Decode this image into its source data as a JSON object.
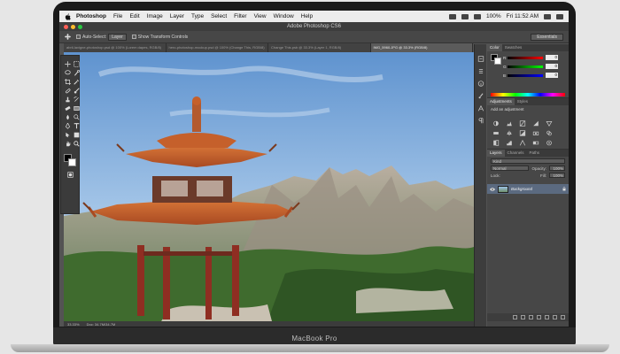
{
  "menubar": {
    "app_name": "Photoshop",
    "items": [
      "File",
      "Edit",
      "Image",
      "Layer",
      "Type",
      "Select",
      "Filter",
      "View",
      "Window",
      "Help"
    ],
    "battery": "100%",
    "clock": "Fri 11:52 AM"
  },
  "window": {
    "title": "Adobe Photoshop CS6"
  },
  "options": {
    "auto_select": "Auto-Select:",
    "auto_select_value": "Layer",
    "show_transform": "Show Transform Controls",
    "workspace": "Essentials"
  },
  "tabs": [
    {
      "label": "abril-lavigne-photoshop.psd @ 100% (Lorem dapes, RGB/8)",
      "active": false
    },
    {
      "label": "hero-photoshop-mockup.psd @ 100% (Change This, RGB/8)",
      "active": false
    },
    {
      "label": "Change This.psb @ 33.3% (Layer 1, RGB/8)",
      "active": false
    },
    {
      "label": "IMG_5960.JPG @ 33.3% (RGB/8)",
      "active": true
    }
  ],
  "status_bar": {
    "zoom": "33.33%",
    "doc": "Doc: 34.7M/34.7M"
  },
  "panels": {
    "color_tabs": [
      "Color",
      "Swatches"
    ],
    "sliders": [
      {
        "letter": "R",
        "value": "0"
      },
      {
        "letter": "G",
        "value": "0"
      },
      {
        "letter": "B",
        "value": "0"
      }
    ],
    "adjust_tabs": [
      "Adjustments",
      "Styles"
    ],
    "adjust_title": "Add an adjustment",
    "layers_tabs": [
      "Layers",
      "Channels",
      "Paths"
    ],
    "kind_label": "Kind",
    "blend_mode": "Normal",
    "opacity_label": "Opacity:",
    "opacity_value": "100%",
    "lock_label": "Lock:",
    "fill_label": "Fill:",
    "fill_value": "100%",
    "layer_name": "Background"
  },
  "colors": {
    "accent_layer": "#5b6a80",
    "pagoda_roof": "#c5602b",
    "pillar_red": "#8f2e22"
  },
  "device": {
    "model": "MacBook Pro"
  }
}
